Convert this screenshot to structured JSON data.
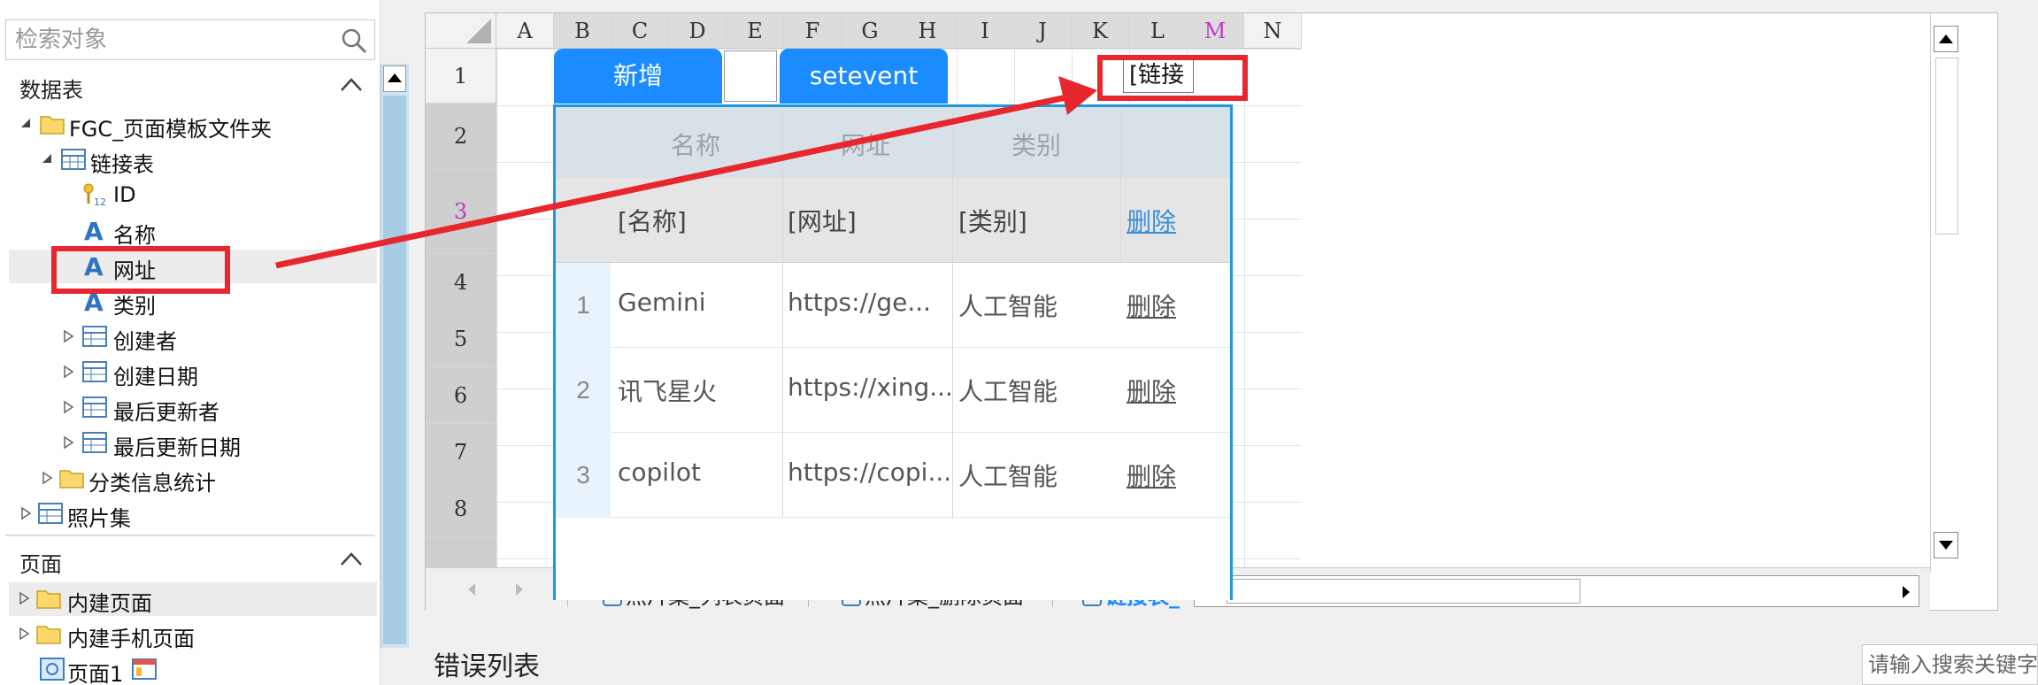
{
  "search": {
    "placeholder": "检索对象"
  },
  "data_table_section": {
    "title": "数据表"
  },
  "tree": [
    {
      "label": "FGC_页面模板文件夹",
      "icon": "folder-icon"
    },
    {
      "label": "链接表",
      "icon": "table-icon"
    },
    {
      "label": "ID",
      "icon": "key-icon"
    },
    {
      "label": "名称",
      "icon": "text-field-icon"
    },
    {
      "label": "网址",
      "icon": "text-field-icon"
    },
    {
      "label": "类别",
      "icon": "text-field-icon"
    },
    {
      "label": "创建者",
      "icon": "table-icon"
    },
    {
      "label": "创建日期",
      "icon": "table-icon"
    },
    {
      "label": "最后更新者",
      "icon": "table-icon"
    },
    {
      "label": "最后更新日期",
      "icon": "table-icon"
    },
    {
      "label": "分类信息统计",
      "icon": "folder-icon"
    },
    {
      "label": "照片集",
      "icon": "table-icon"
    }
  ],
  "pages_section": {
    "title": "页面",
    "items": [
      {
        "label": "内建页面",
        "icon": "folder-icon"
      },
      {
        "label": "内建手机页面",
        "icon": "folder-icon"
      },
      {
        "label": "页面1",
        "icon": "page-icon"
      }
    ]
  },
  "sheet": {
    "columns": [
      "A",
      "B",
      "C",
      "D",
      "E",
      "F",
      "G",
      "H",
      "I",
      "J",
      "K",
      "L",
      "M",
      "N"
    ],
    "rows": [
      "1",
      "2",
      "3",
      "4",
      "5",
      "6",
      "7",
      "8"
    ],
    "btn_add": "新增",
    "btn_setevent": "setevent",
    "inline_cell": "[链接",
    "headers": [
      "名称",
      "网址",
      "类别"
    ],
    "bind_row": [
      "[名称]",
      "[网址]",
      "[类别]",
      "删除"
    ],
    "data": [
      {
        "idx": "1",
        "name": "Gemini",
        "url": "https://ge...",
        "type": "人工智能",
        "action": "删除"
      },
      {
        "idx": "2",
        "name": "讯飞星火",
        "url": "https://xing...",
        "type": "人工智能",
        "action": "删除"
      },
      {
        "idx": "3",
        "name": "copilot",
        "url": "https://copi...",
        "type": "人工智能",
        "action": "删除"
      }
    ]
  },
  "tabs": [
    "照片集_列表页面",
    "照片集_删除页面",
    "链接表_"
  ],
  "errors": {
    "title": "错误列表"
  },
  "keyword_search": {
    "placeholder": "请输入搜索关键字"
  },
  "colors": {
    "accent": "#1a8cff",
    "annotation": "#e8262d",
    "table_border": "#1a9ae0"
  }
}
